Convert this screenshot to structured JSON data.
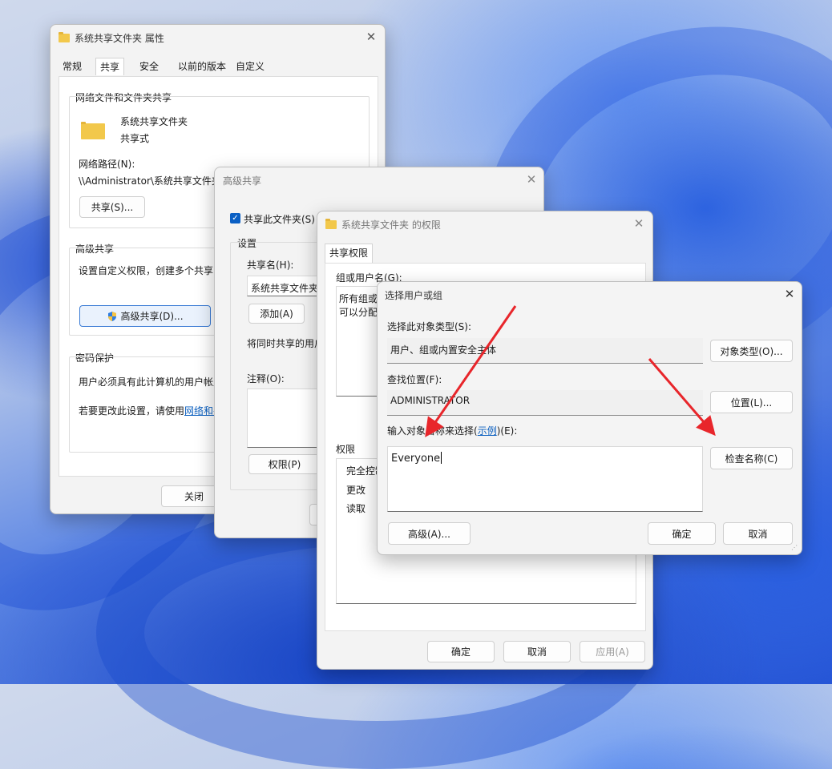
{
  "props_window": {
    "title": "系统共享文件夹 属性",
    "tabs": [
      "常规",
      "共享",
      "安全",
      "以前的版本",
      "自定义"
    ],
    "net_section_title": "网络文件和文件夹共享",
    "folder_name": "系统共享文件夹",
    "share_state": "共享式",
    "net_path_label": "网络路径(N):",
    "net_path_value": "\\\\Administrator\\系统共享文件夹",
    "share_button": "共享(S)...",
    "adv_section_title": "高级共享",
    "adv_desc": "设置自定义权限，创建多个共享，",
    "adv_button": "高级共享(D)...",
    "pw_section_title": "密码保护",
    "pw_desc": "用户必须具有此计算机的用户帐户",
    "pw_change_prefix": "若要更改此设置，请使用",
    "pw_link": "网络和共",
    "close_button": "关闭"
  },
  "adv_window": {
    "title": "高级共享",
    "share_checkbox": "共享此文件夹(S)",
    "settings_title": "设置",
    "share_name_label": "共享名(H):",
    "share_name_value": "系统共享文件夹",
    "add_button": "添加(A)",
    "limit_text": "将同时共享的用户",
    "comment_label": "注释(O):",
    "perm_button": "权限(P)"
  },
  "perm_window": {
    "title": "系统共享文件夹 的权限",
    "tab": "共享权限",
    "group_label": "组或用户名(G):",
    "group_text_1": "所有组或",
    "group_text_2": "可以分配",
    "perm_label": "权限",
    "perm_rows": [
      "完全控制",
      "更改",
      "读取"
    ],
    "ok": "确定",
    "cancel": "取消",
    "apply": "应用(A)"
  },
  "select_window": {
    "title": "选择用户或组",
    "obj_type_label": "选择此对象类型(S):",
    "obj_type_value": "用户、组或内置安全主体",
    "obj_type_button": "对象类型(O)...",
    "location_label": "查找位置(F):",
    "location_value": "ADMINISTRATOR",
    "location_button": "位置(L)...",
    "enter_label_prefix": "输入对象名称来选择(",
    "enter_label_link": "示例",
    "enter_label_suffix": ")(E):",
    "enter_value": "Everyone",
    "check_names_button": "检查名称(C)",
    "advanced_button": "高级(A)...",
    "ok": "确定",
    "cancel": "取消"
  },
  "colors": {
    "arrow": "#e8262b",
    "accent": "#0a5fc4"
  }
}
